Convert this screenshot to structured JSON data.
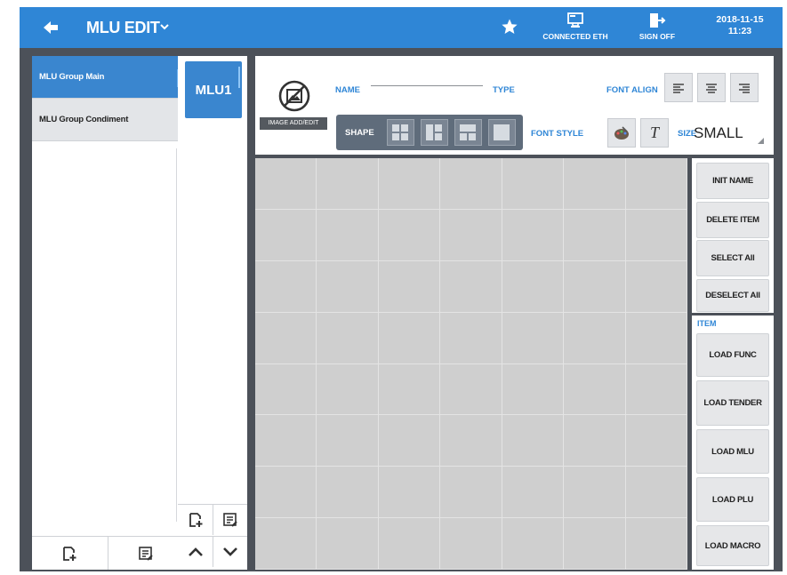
{
  "header": {
    "title": "MLU EDIT",
    "connection_label": "CONNECTED ETH",
    "sign_off_label": "SIGN OFF",
    "date": "2018-11-15",
    "time": "11:23"
  },
  "groups": {
    "items": [
      {
        "label": "MLU Group Main",
        "active": true
      },
      {
        "label": "MLU Group Condiment",
        "active": false
      }
    ]
  },
  "mlu": {
    "tab_label": "MLU1"
  },
  "props": {
    "image_label": "IMAGE ADD/EDIT",
    "name_label": "NAME",
    "type_label": "TYPE",
    "font_align_label": "FONT ALIGN",
    "shape_label": "SHAPE",
    "font_style_label": "FONT STYLE",
    "font_style_t": "T",
    "size_label": "SIZE",
    "size_value": "SMALL"
  },
  "actions": {
    "init_name": "INIT NAME",
    "delete_item": "DELETE ITEM",
    "select_all": "SELECT All",
    "deselect_all": "DESELECT All",
    "item_section": "ITEM",
    "load_func": "LOAD FUNC",
    "load_tender": "LOAD TENDER",
    "load_mlu": "LOAD MLU",
    "load_plu": "LOAD PLU",
    "load_macro": "LOAD MACRO"
  },
  "colors": {
    "accent": "#2f86d6",
    "frame": "#4c5159",
    "grid_cell": "#cfcfcf"
  }
}
